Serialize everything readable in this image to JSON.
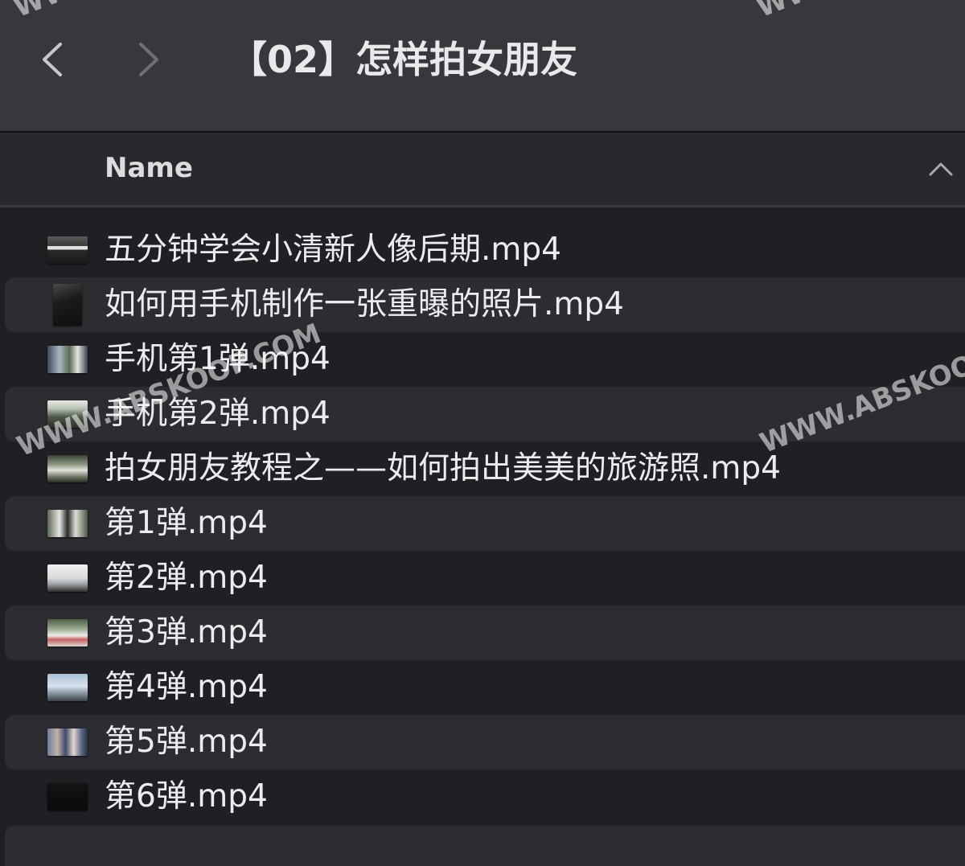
{
  "window": {
    "title": "【02】怎样拍女朋友",
    "back_icon": "chevron-left-icon",
    "forward_icon": "chevron-right-icon"
  },
  "columns": {
    "name_label": "Name",
    "sort_icon": "chevron-up-icon"
  },
  "files": [
    {
      "name": "五分钟学会小清新人像后期.mp4",
      "thumb": "landscape-dark"
    },
    {
      "name": "如何用手机制作一张重曝的照片.mp4",
      "thumb": "portrait-dark"
    },
    {
      "name": "手机第1弹.mp4",
      "thumb": "landscape-photo"
    },
    {
      "name": "手机第2弹.mp4",
      "thumb": "landscape-photo"
    },
    {
      "name": "拍女朋友教程之——如何拍出美美的旅游照.mp4",
      "thumb": "landscape-photo"
    },
    {
      "name": "第1弹.mp4",
      "thumb": "landscape-photo"
    },
    {
      "name": "第2弹.mp4",
      "thumb": "landscape-light"
    },
    {
      "name": "第3弹.mp4",
      "thumb": "landscape-light"
    },
    {
      "name": "第4弹.mp4",
      "thumb": "landscape-sky"
    },
    {
      "name": "第5弹.mp4",
      "thumb": "landscape-photo"
    },
    {
      "name": "第6弹.mp4",
      "thumb": "landscape-black"
    }
  ],
  "watermarks": [
    "WWW.ABSKOOP.COM",
    "WWW.ABSKOOP.COM",
    "WWW.",
    "WWW."
  ],
  "colors": {
    "titlebar": "#38383c",
    "header": "#29292d",
    "background": "#1f1f24",
    "stripe": "#2c2c31",
    "text": "#ececef"
  }
}
